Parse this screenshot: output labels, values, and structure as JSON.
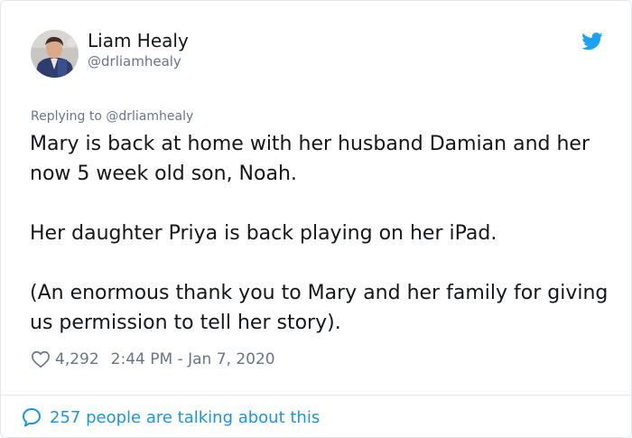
{
  "author": {
    "name": "Liam Healy",
    "handle": "@drliamhealy"
  },
  "replying_to": "Replying to @drliamhealy",
  "tweet": {
    "paragraphs": [
      "Mary is back at home with her husband Damian and her now 5 week old son, Noah.",
      "Her daughter Priya is back playing on her iPad.",
      "(An enormous thank you to Mary and her family for giving us permission to tell her story)."
    ]
  },
  "meta": {
    "likes": "4,292",
    "timestamp": "2:44 PM - Jan 7, 2020"
  },
  "footer": {
    "talking": "257 people are talking about this"
  },
  "icons": {
    "brand": "twitter-bird-icon",
    "like": "heart-icon",
    "conversation": "speech-bubble-icon"
  },
  "colors": {
    "twitter_blue": "#1da1f2",
    "link_blue": "#1b95e0",
    "secondary_text": "#657786",
    "primary_text": "#14171a",
    "border": "#e1e8ed"
  }
}
